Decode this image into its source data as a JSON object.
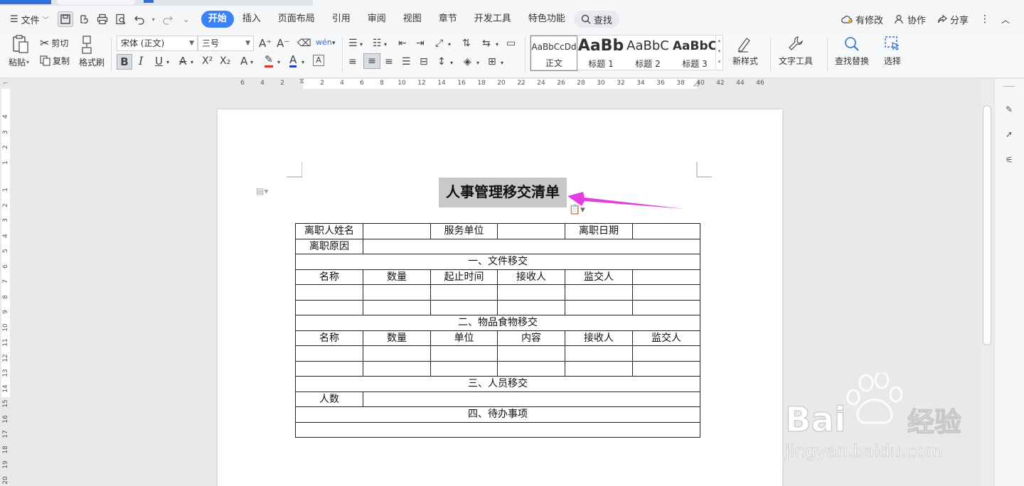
{
  "menubar": {
    "file_label": "文件",
    "tabs": [
      "开始",
      "插入",
      "页面布局",
      "引用",
      "审阅",
      "视图",
      "章节",
      "开发工具",
      "特色功能"
    ],
    "search_label": "查找",
    "right": {
      "modified": "有修改",
      "collab": "协作",
      "share": "分享"
    }
  },
  "ribbon": {
    "paste": "粘贴",
    "cut": "剪切",
    "copy": "复制",
    "format_painter": "格式刷",
    "font_name": "宋体 (正文)",
    "font_size": "三号",
    "styles": [
      {
        "sample": "AaBbCcDd",
        "name": "正文"
      },
      {
        "sample": "AaBb",
        "name": "标题 1"
      },
      {
        "sample": "AaBbC",
        "name": "标题 2"
      },
      {
        "sample": "AaBbC",
        "name": "标题 3"
      }
    ],
    "new_style": "新样式",
    "text_tools": "文字工具",
    "find_replace": "查找替换",
    "select": "选择"
  },
  "ruler": {
    "top": [
      "6",
      "4",
      "2",
      "2",
      "4",
      "6",
      "8",
      "10",
      "12",
      "14",
      "16",
      "18",
      "20",
      "22",
      "24",
      "26",
      "28",
      "30",
      "32",
      "34",
      "36",
      "38",
      "40",
      "42",
      "44",
      "46"
    ],
    "left": [
      "4",
      "3",
      "2",
      "1",
      "1",
      "2",
      "3",
      "4",
      "5",
      "6",
      "7",
      "8",
      "9",
      "10",
      "11",
      "12",
      "13",
      "14",
      "15",
      "16",
      "17",
      "18",
      "19",
      "20"
    ]
  },
  "document": {
    "title": "人事管理移交清单",
    "row1": [
      "离职人姓名",
      "",
      "服务单位",
      "",
      "离职日期",
      ""
    ],
    "row2_label": "离职原因",
    "section1": "一、文件移交",
    "section1_header": [
      "名称",
      "数量",
      "起止时间",
      "接收人",
      "监交人",
      ""
    ],
    "section2": "二、物品食物移交",
    "section2_header": [
      "名称",
      "数量",
      "单位",
      "内容",
      "接收人",
      "监交人"
    ],
    "section3": "三、人员移交",
    "headcount_label": "人数",
    "section4": "四、待办事项"
  },
  "watermark": {
    "brand": "Bai",
    "brand_cn": "经验",
    "url": "jingyan.baidu.com"
  }
}
